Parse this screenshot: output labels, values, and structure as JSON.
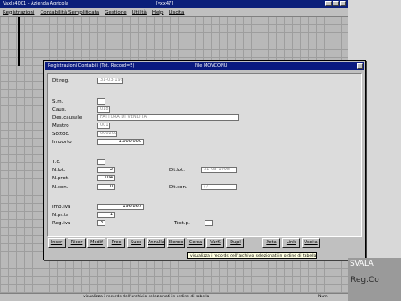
{
  "app": {
    "title": "Vaxlx4001 - Azienda Agricola",
    "title_code": "[vxx47]",
    "menu": [
      "Registrazioni",
      "Contabilità Semplificata",
      "Gestione",
      "Utilità",
      "Help",
      "Uscita"
    ]
  },
  "dialog": {
    "title": "Registrazioni Contabili (Tot. Record=5)",
    "subtitle": "File MOVCONU",
    "fields": {
      "dtreg": {
        "label": "Dt.reg.",
        "value": "31-03-1998"
      },
      "sez": {
        "label": "S.m.",
        "value": ""
      },
      "caus": {
        "label": "Caus.",
        "value": "018"
      },
      "descausale": {
        "label": "Des.causale",
        "value": "FATTURA DI VENDITA"
      },
      "mastro": {
        "label": "Mastro",
        "value": "001"
      },
      "sottoc": {
        "label": "Sottoc.",
        "value": "000200"
      },
      "importo": {
        "label": "Importo",
        "value": "1.000.000"
      },
      "tc": {
        "label": "T.c.",
        "value": ""
      },
      "nlot": {
        "label": "N.lot.",
        "value": "2"
      },
      "nprot": {
        "label": "N.prot.",
        "value": "104"
      },
      "ncon": {
        "label": "N.con.",
        "value": "0"
      },
      "dtlot": {
        "label": "Dt.lot.",
        "value": "31-03-1998"
      },
      "dtcon": {
        "label": "Dt.con.",
        "value": "/ /"
      },
      "impiva": {
        "label": "Imp.iva",
        "value": "196.867"
      },
      "nprta": {
        "label": "N.pr.ta",
        "value": "1"
      },
      "regiva": {
        "label": "Reg.iva",
        "value": "3"
      },
      "testp": {
        "label": "Test.p.",
        "value": ""
      }
    },
    "buttons": [
      "Inser",
      "Ricer",
      "Modif",
      "Prec",
      "Succ",
      "Annulla",
      "Elenco",
      "Cerca",
      "VarK",
      "Dupl",
      "Xeta",
      "Link",
      "Uscita"
    ]
  },
  "tooltip": "visualizza i records dell'archivio selezionati in ordine di tabella",
  "status": {
    "text": "visualizza i records dell'archivio selezionati in ordine di tabella",
    "indicator": "Num"
  },
  "corner": {
    "line1": "SVALA",
    "line2": "Reg.Co"
  }
}
